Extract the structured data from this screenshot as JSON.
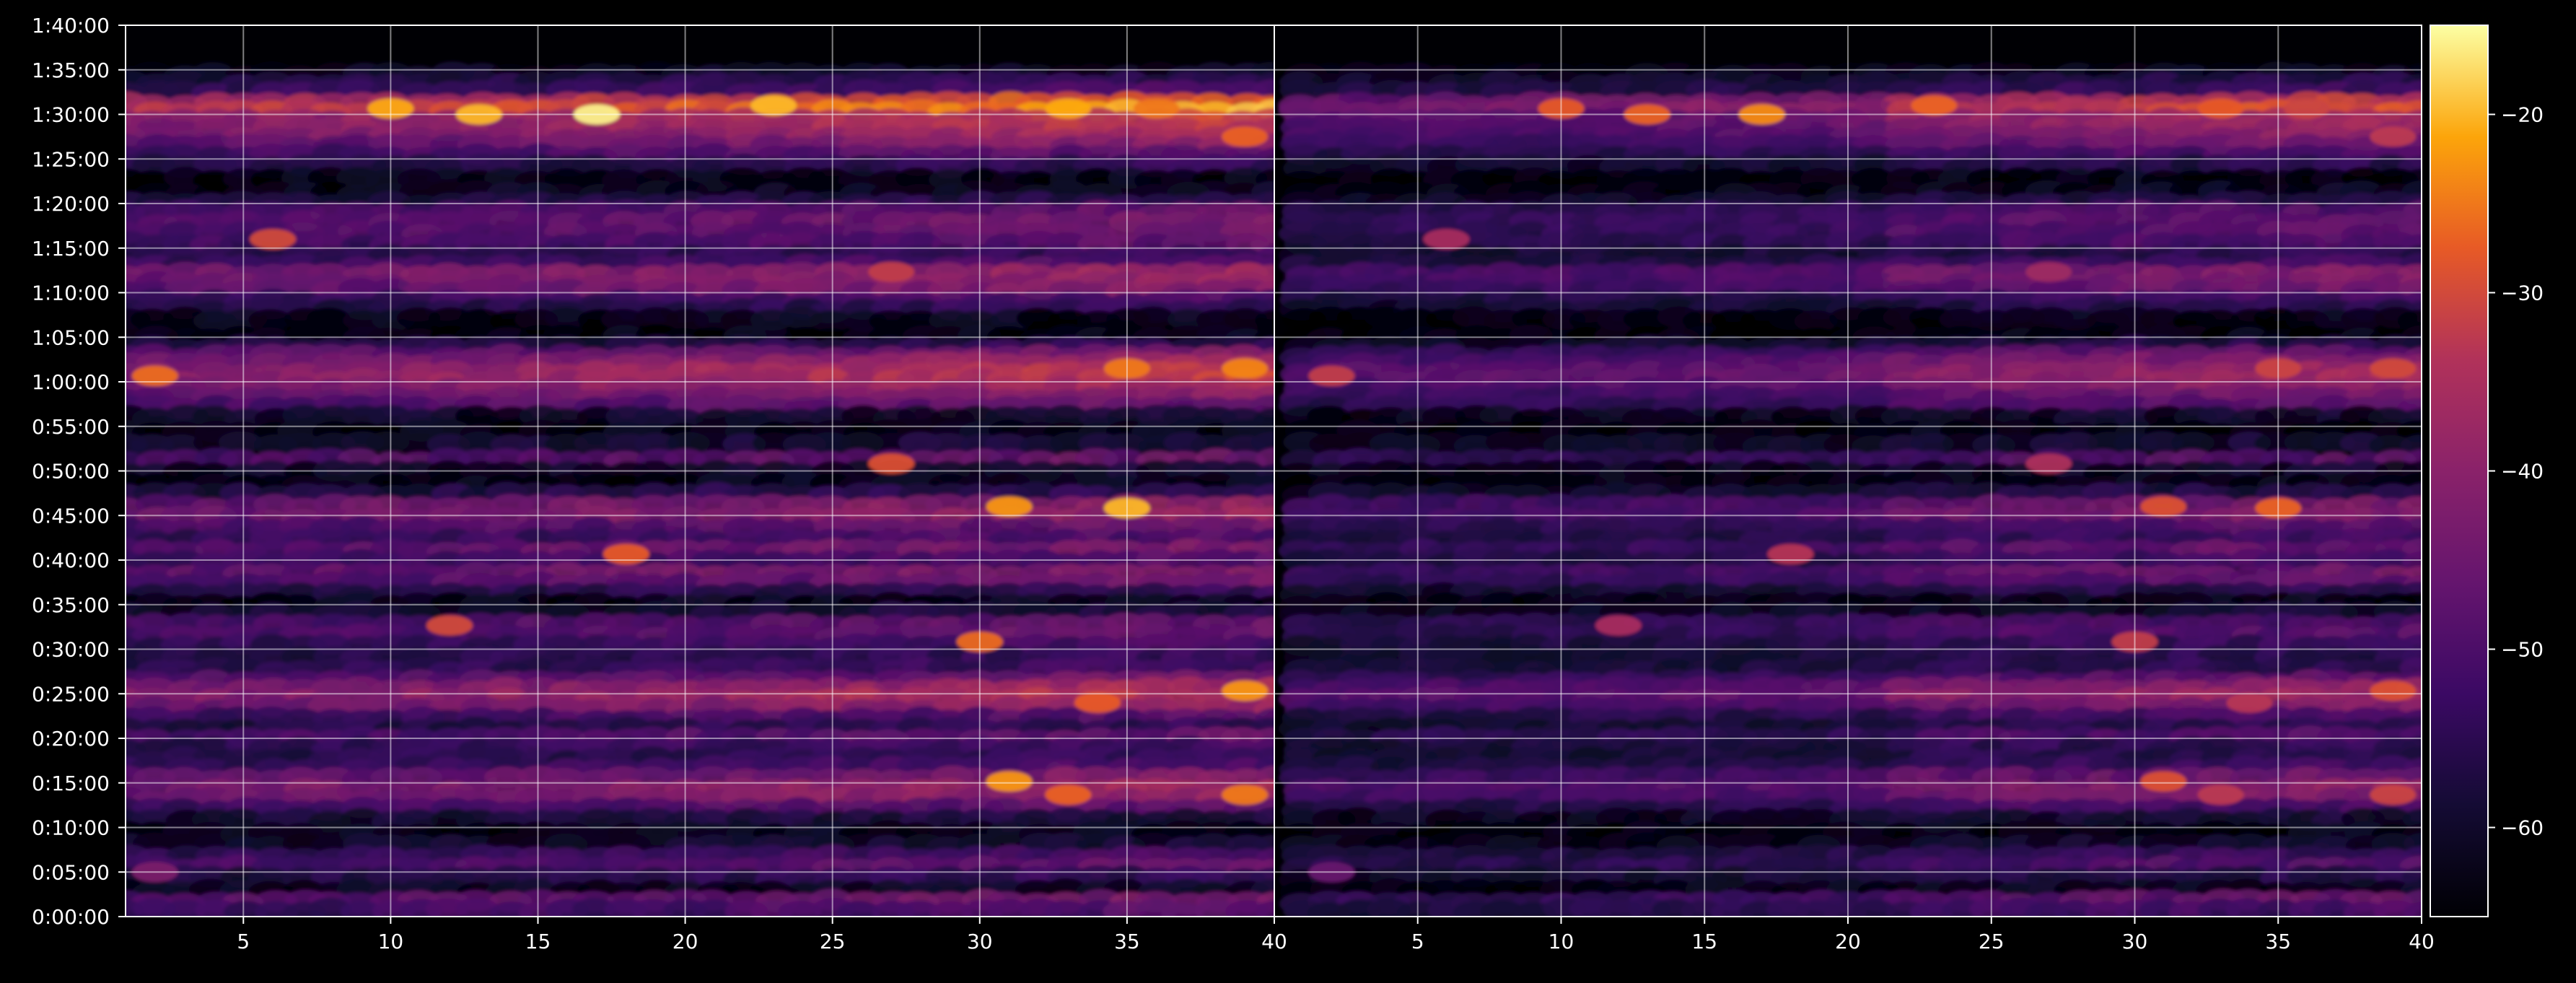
{
  "chart_data": {
    "type": "heatmap",
    "title": "",
    "xlabel": "",
    "ylabel": "",
    "panels": [
      {
        "name": "",
        "xlim": [
          1,
          40
        ],
        "xticks": [
          5,
          10,
          15,
          20,
          25,
          30,
          35,
          40
        ]
      },
      {
        "name": "",
        "xlim": [
          0,
          40
        ],
        "xticks": [
          5,
          10,
          15,
          20,
          25,
          30,
          35,
          40
        ]
      }
    ],
    "y_axis": {
      "ylim_seconds": [
        0,
        6000
      ],
      "tick_values_seconds": [
        0,
        300,
        600,
        900,
        1200,
        1500,
        1800,
        2100,
        2400,
        2700,
        3000,
        3300,
        3600,
        3900,
        4200,
        4500,
        4800,
        5100,
        5400,
        5700,
        6000
      ],
      "tick_labels": [
        "0:00:00",
        "0:05:00",
        "0:10:00",
        "0:15:00",
        "0:20:00",
        "0:25:00",
        "0:30:00",
        "0:35:00",
        "0:40:00",
        "0:45:00",
        "0:50:00",
        "0:55:00",
        "1:00:00",
        "1:05:00",
        "1:10:00",
        "1:15:00",
        "1:20:00",
        "1:25:00",
        "1:30:00",
        "1:35:00",
        "1:40:00"
      ]
    },
    "x_tick_labels": [
      "5",
      "10",
      "15",
      "20",
      "25",
      "30",
      "35",
      "40"
    ],
    "grid": true,
    "colormap": "inferno",
    "colorbar": {
      "range": [
        -65,
        -15
      ],
      "ticks": [
        -20,
        -30,
        -40,
        -50,
        -60
      ],
      "tick_labels": [
        "−20",
        "−30",
        "−40",
        "−50",
        "−60"
      ]
    },
    "bands": [
      {
        "t": 5670,
        "level": 0.1
      },
      {
        "t": 5610,
        "level": 0.2
      },
      {
        "t": 5550,
        "level": 0.28
      },
      {
        "t": 5470,
        "level": 0.72
      },
      {
        "t": 5420,
        "level": 0.8
      },
      {
        "t": 5360,
        "level": 0.62
      },
      {
        "t": 5300,
        "level": 0.6
      },
      {
        "t": 5240,
        "level": 0.55
      },
      {
        "t": 5190,
        "level": 0.45
      },
      {
        "t": 5120,
        "level": 0.33
      },
      {
        "t": 5050,
        "level": 0.2
      },
      {
        "t": 4960,
        "level": 0.05
      },
      {
        "t": 4870,
        "level": 0.08
      },
      {
        "t": 4800,
        "level": 0.18
      },
      {
        "t": 4740,
        "level": 0.36
      },
      {
        "t": 4670,
        "level": 0.4
      },
      {
        "t": 4600,
        "level": 0.38
      },
      {
        "t": 4530,
        "level": 0.33
      },
      {
        "t": 4440,
        "level": 0.22
      },
      {
        "t": 4380,
        "level": 0.3
      },
      {
        "t": 4320,
        "level": 0.52
      },
      {
        "t": 4260,
        "level": 0.5
      },
      {
        "t": 4210,
        "level": 0.45
      },
      {
        "t": 4140,
        "level": 0.28
      },
      {
        "t": 4080,
        "level": 0.2
      },
      {
        "t": 4020,
        "level": 0.05
      },
      {
        "t": 3900,
        "level": 0.05
      },
      {
        "t": 3830,
        "level": 0.2
      },
      {
        "t": 3770,
        "level": 0.42
      },
      {
        "t": 3720,
        "level": 0.52
      },
      {
        "t": 3660,
        "level": 0.6
      },
      {
        "t": 3610,
        "level": 0.62
      },
      {
        "t": 3550,
        "level": 0.55
      },
      {
        "t": 3490,
        "level": 0.45
      },
      {
        "t": 3430,
        "level": 0.36
      },
      {
        "t": 3360,
        "level": 0.1
      },
      {
        "t": 3260,
        "level": 0.05
      },
      {
        "t": 3180,
        "level": 0.14
      },
      {
        "t": 3070,
        "level": 0.38
      },
      {
        "t": 2990,
        "level": 0.1
      },
      {
        "t": 2910,
        "level": 0.05
      },
      {
        "t": 2840,
        "level": 0.2
      },
      {
        "t": 2760,
        "level": 0.48
      },
      {
        "t": 2680,
        "level": 0.5
      },
      {
        "t": 2610,
        "level": 0.36
      },
      {
        "t": 2530,
        "level": 0.28
      },
      {
        "t": 2460,
        "level": 0.42
      },
      {
        "t": 2390,
        "level": 0.3
      },
      {
        "t": 2300,
        "level": 0.45
      },
      {
        "t": 2240,
        "level": 0.38
      },
      {
        "t": 2170,
        "level": 0.2
      },
      {
        "t": 2100,
        "level": 0.05
      },
      {
        "t": 2040,
        "level": 0.14
      },
      {
        "t": 1960,
        "level": 0.36
      },
      {
        "t": 1890,
        "level": 0.36
      },
      {
        "t": 1820,
        "level": 0.26
      },
      {
        "t": 1740,
        "level": 0.22
      },
      {
        "t": 1660,
        "level": 0.24
      },
      {
        "t": 1580,
        "level": 0.4
      },
      {
        "t": 1530,
        "level": 0.55
      },
      {
        "t": 1460,
        "level": 0.6
      },
      {
        "t": 1400,
        "level": 0.5
      },
      {
        "t": 1330,
        "level": 0.3
      },
      {
        "t": 1260,
        "level": 0.2
      },
      {
        "t": 1200,
        "level": 0.35
      },
      {
        "t": 1130,
        "level": 0.24
      },
      {
        "t": 1060,
        "level": 0.22
      },
      {
        "t": 1000,
        "level": 0.28
      },
      {
        "t": 930,
        "level": 0.45
      },
      {
        "t": 850,
        "level": 0.55
      },
      {
        "t": 790,
        "level": 0.5
      },
      {
        "t": 720,
        "level": 0.32
      },
      {
        "t": 650,
        "level": 0.14
      },
      {
        "t": 560,
        "level": 0.06
      },
      {
        "t": 480,
        "level": 0.12
      },
      {
        "t": 400,
        "level": 0.28
      },
      {
        "t": 330,
        "level": 0.35
      },
      {
        "t": 260,
        "level": 0.2
      },
      {
        "t": 170,
        "level": 0.08
      },
      {
        "t": 100,
        "level": 0.42
      },
      {
        "t": 40,
        "level": 0.3
      }
    ],
    "hotspots": [
      {
        "x": 10,
        "t": 5440,
        "level": 0.88
      },
      {
        "x": 13,
        "t": 5400,
        "level": 0.9
      },
      {
        "x": 17,
        "t": 5400,
        "level": 0.98
      },
      {
        "x": 23,
        "t": 5460,
        "level": 0.9
      },
      {
        "x": 33,
        "t": 5440,
        "level": 0.88
      },
      {
        "x": 36,
        "t": 5440,
        "level": 0.8
      },
      {
        "x": 2,
        "t": 3640,
        "level": 0.78
      },
      {
        "x": 35,
        "t": 3690,
        "level": 0.8
      },
      {
        "x": 39,
        "t": 3690,
        "level": 0.82
      },
      {
        "x": 31,
        "t": 2760,
        "level": 0.85
      },
      {
        "x": 35,
        "t": 2750,
        "level": 0.9
      },
      {
        "x": 18,
        "t": 2440,
        "level": 0.75
      },
      {
        "x": 27,
        "t": 3050,
        "level": 0.72
      },
      {
        "x": 30,
        "t": 1850,
        "level": 0.78
      },
      {
        "x": 12,
        "t": 1960,
        "level": 0.7
      },
      {
        "x": 39,
        "t": 1520,
        "level": 0.85
      },
      {
        "x": 34,
        "t": 1440,
        "level": 0.75
      },
      {
        "x": 31,
        "t": 910,
        "level": 0.85
      },
      {
        "x": 33,
        "t": 820,
        "level": 0.76
      },
      {
        "x": 39,
        "t": 820,
        "level": 0.8
      },
      {
        "x": 6,
        "t": 4560,
        "level": 0.7
      },
      {
        "x": 39,
        "t": 5250,
        "level": 0.76
      },
      {
        "x": 27,
        "t": 4340,
        "level": 0.66
      },
      {
        "x": 2,
        "t": 300,
        "level": 0.45
      }
    ]
  }
}
